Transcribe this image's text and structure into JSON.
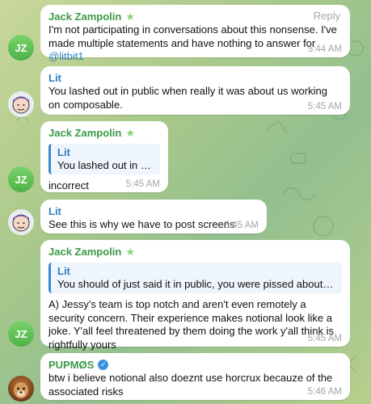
{
  "messages": [
    {
      "sender": "Jack Zampolin",
      "avatar_initials": "JZ",
      "action": "Reply",
      "text": "I'm not participating in conversations about this nonsense. I've made multiple statements and have nothing to answer for ",
      "mention": "@litbit1",
      "time": "5:44 AM"
    },
    {
      "sender": "Lit",
      "text": "You lashed out in public when really it was about us working on composable.",
      "time": "5:45 AM"
    },
    {
      "sender": "Jack Zampolin",
      "avatar_initials": "JZ",
      "quote_sender": "Lit",
      "quote_text": "You lashed out in publ…",
      "text": "incorrect",
      "time": "5:45 AM"
    },
    {
      "sender": "Lit",
      "text": "See this is why we have to post screens",
      "time": "5:45 AM"
    },
    {
      "sender": "Jack Zampolin",
      "avatar_initials": "JZ",
      "quote_sender": "Lit",
      "quote_text": "You should of just said it in public, you were pissed about compo…",
      "text": "A) Jessy's team is top notch and aren't even remotely a security concern. Their experience makes notional look like a joke. Y'all feel threatened by them doing the work y'all think is rightfully yours",
      "time": "5:45 AM"
    },
    {
      "sender": "PUPMØS",
      "text": "btw i believe notional also doeznt use horcrux becauze of the associated risks",
      "time": "5:46 AM"
    }
  ],
  "colors": {
    "name_green": "#3e9b45",
    "name_blue": "#2f7fbf",
    "bubble": "#ffffff",
    "timestamp": "#a0a6ad"
  },
  "icons": [
    "star-icon",
    "verified-icon"
  ]
}
